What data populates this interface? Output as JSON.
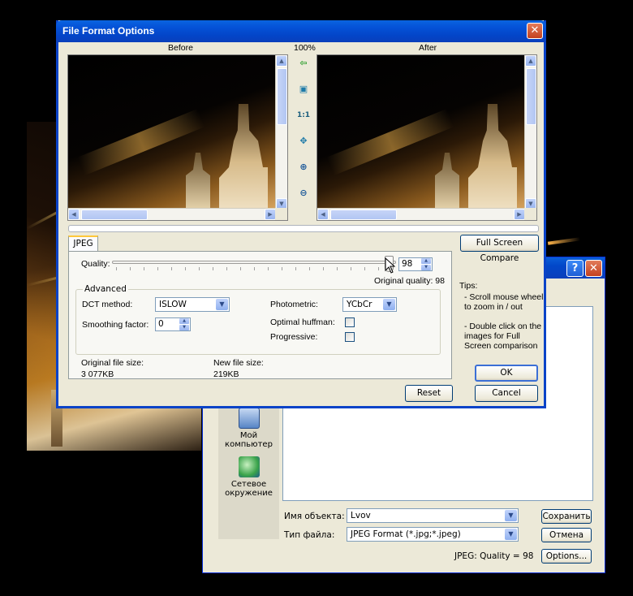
{
  "save_dialog": {
    "places": [
      {
        "label": "Мой компьютер",
        "icon": "my-computer-icon"
      },
      {
        "label": "Сетевое окружение",
        "icon": "network-places-icon"
      }
    ],
    "filename_label": "Имя объекта:",
    "filename_value": "Lvov",
    "filetype_label": "Тип файла:",
    "filetype_value": "JPEG Format (*.jpg;*.jpeg)",
    "save_button": "Сохранить",
    "cancel_button": "Отмена",
    "options_button": "Options...",
    "quality_note": "JPEG: Quality = 98",
    "help_glyph": "?",
    "close_glyph": "✕"
  },
  "ffo": {
    "title": "File Format Options",
    "close_glyph": "✕",
    "before_label": "Before",
    "zoom_label": "100%",
    "after_label": "After",
    "tools": [
      {
        "name": "back-arrow-icon",
        "glyph": "⇦"
      },
      {
        "name": "fit-window-icon",
        "glyph": "▣"
      },
      {
        "name": "actual-size-icon",
        "glyph": "1:1"
      },
      {
        "name": "pan-icon",
        "glyph": "✥"
      },
      {
        "name": "zoom-in-icon",
        "glyph": "⊕"
      },
      {
        "name": "zoom-out-icon",
        "glyph": "⊖"
      }
    ],
    "tab_label": "JPEG",
    "full_screen_button": "Full Screen Compare",
    "quality_label": "Quality:",
    "quality_value": "98",
    "original_quality": "Original quality: 98",
    "advanced_title": "Advanced",
    "dct_label": "DCT method:",
    "dct_value": "ISLOW",
    "smoothing_label": "Smoothing factor:",
    "smoothing_value": "0",
    "photometric_label": "Photometric:",
    "photometric_value": "YCbCr",
    "optimal_huffman_label": "Optimal huffman:",
    "progressive_label": "Progressive:",
    "orig_size_label": "Original file size:",
    "orig_size_value": "3 077KB",
    "new_size_label": "New file size:",
    "new_size_value": "219KB",
    "tips_title": "Tips:",
    "tip1": "- Scroll mouse wheel to zoom in / out",
    "tip2": "- Double click on the images for Full Screen comparison",
    "ok_button": "OK",
    "cancel_button": "Cancel",
    "reset_button": "Reset"
  },
  "colors": {
    "title_blue": "#0a43c8",
    "dialog_face": "#ece9d8",
    "close_red": "#c4411f"
  }
}
